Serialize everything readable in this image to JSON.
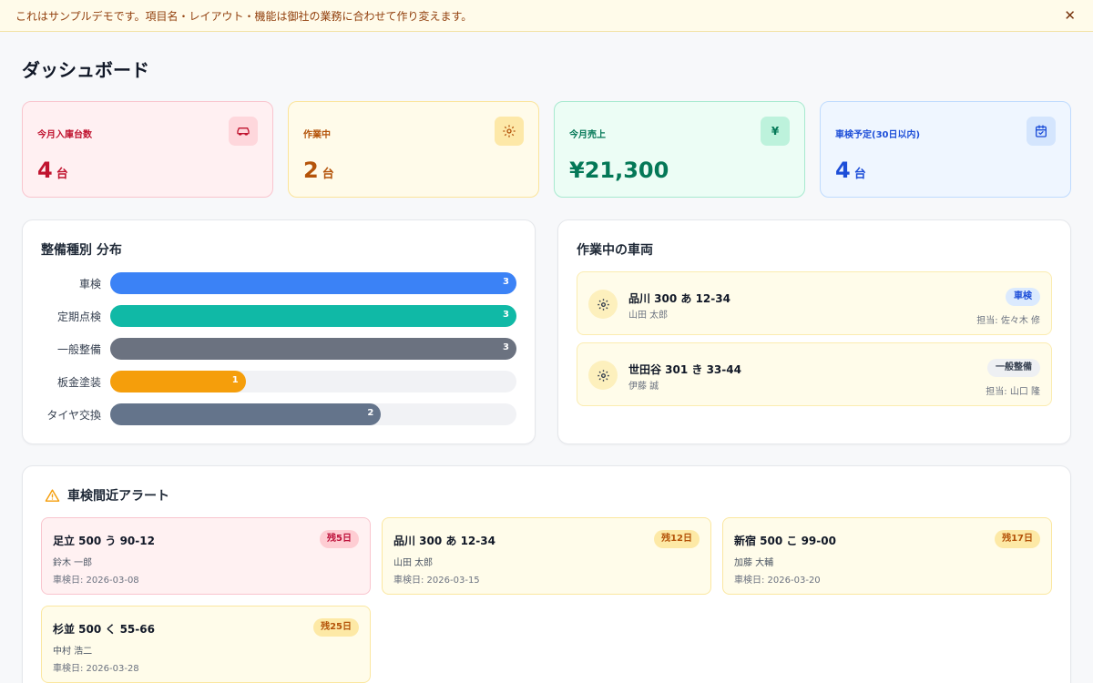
{
  "banner": {
    "text": "これはサンプルデモです。項目名・レイアウト・機能は御社の業務に合わせて作り変えます。",
    "close": "✕"
  },
  "page": {
    "title": "ダッシュボード"
  },
  "kpis": [
    {
      "label": "今月入庫台数",
      "value": "4",
      "unit": "台",
      "icon": "car-icon"
    },
    {
      "label": "作業中",
      "value": "2",
      "unit": "台",
      "icon": "gear-icon"
    },
    {
      "label": "今月売上",
      "value": "¥21,300",
      "unit": "",
      "icon": "yen-icon",
      "icon_text": "¥"
    },
    {
      "label": "車検予定(30日以内)",
      "value": "4",
      "unit": "台",
      "icon": "calendar-check-icon"
    }
  ],
  "distribution": {
    "title": "整備種別 分布",
    "chart_data": {
      "type": "bar",
      "orientation": "horizontal",
      "categories": [
        "車検",
        "定期点検",
        "一般整備",
        "板金塗装",
        "タイヤ交換"
      ],
      "values": [
        3,
        3,
        3,
        1,
        2
      ],
      "colors": [
        "#3b82f6",
        "#10b9a6",
        "#6b7280",
        "#f59e0b",
        "#64748b"
      ],
      "xlim": [
        0,
        3
      ]
    }
  },
  "in_progress": {
    "title": "作業中の車両",
    "vehicles": [
      {
        "plate": "品川 300 あ 12-34",
        "owner": "山田 太郎",
        "badge": "車検",
        "staff": "担当: 佐々木 修"
      },
      {
        "plate": "世田谷 301 き 33-44",
        "owner": "伊藤 誠",
        "badge": "一般整備",
        "staff": "担当: 山口 隆"
      }
    ]
  },
  "alerts": {
    "title": "車検間近アラート",
    "items": [
      {
        "plate": "足立 500 う 90-12",
        "owner": "鈴木 一郎",
        "date": "車検日: 2026-03-08",
        "badge": "残5日",
        "level": "red"
      },
      {
        "plate": "品川 300 あ 12-34",
        "owner": "山田 太郎",
        "date": "車検日: 2026-03-15",
        "badge": "残12日",
        "level": "amber"
      },
      {
        "plate": "新宿 500 こ 99-00",
        "owner": "加藤 大輔",
        "date": "車検日: 2026-03-20",
        "badge": "残17日",
        "level": "amber"
      },
      {
        "plate": "杉並 500 く 55-66",
        "owner": "中村 浩二",
        "date": "車検日: 2026-03-28",
        "badge": "残25日",
        "level": "amber"
      }
    ]
  }
}
